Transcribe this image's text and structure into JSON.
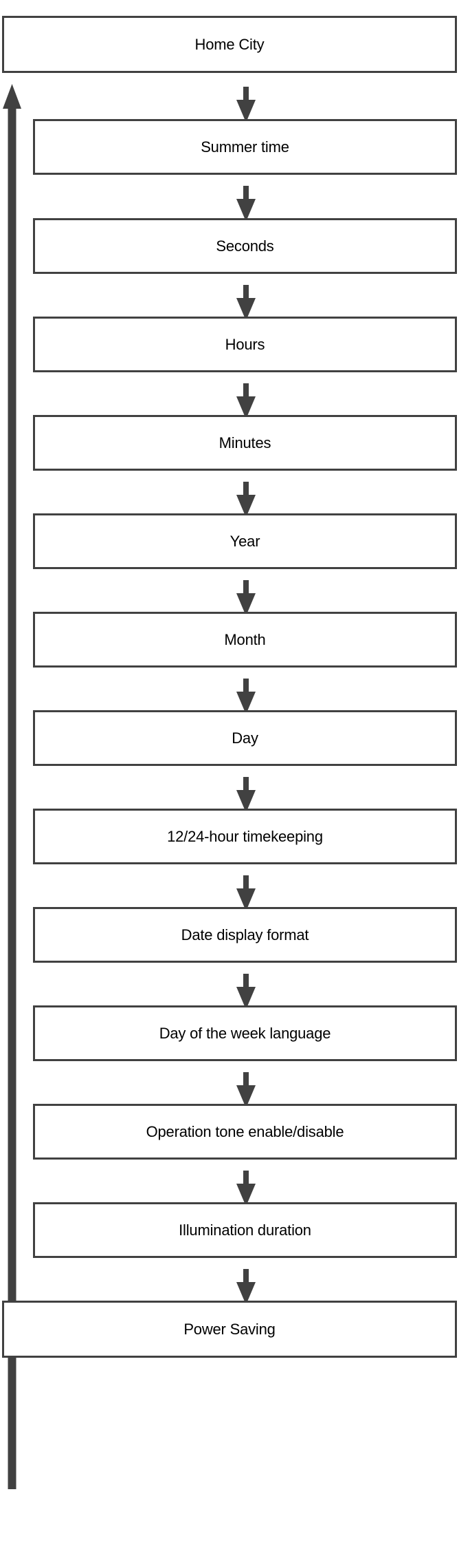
{
  "diagram": {
    "title": "Home City",
    "type": "vertical-flow-loop",
    "accent_color": "#414141",
    "text_color": "#000000",
    "background_color": "#ffffff",
    "nodes": [
      {
        "id": "home-city",
        "label": "Home City"
      },
      {
        "id": "summer-time",
        "label": "Summer time"
      },
      {
        "id": "seconds",
        "label": "Seconds"
      },
      {
        "id": "hours",
        "label": "Hours"
      },
      {
        "id": "minutes",
        "label": "Minutes"
      },
      {
        "id": "year",
        "label": "Year"
      },
      {
        "id": "month",
        "label": "Month"
      },
      {
        "id": "day",
        "label": "Day"
      },
      {
        "id": "timekeeping",
        "label": "12/24-hour timekeeping"
      },
      {
        "id": "date-format",
        "label": "Date display format"
      },
      {
        "id": "weekday-language",
        "label": "Day of the week language"
      },
      {
        "id": "operation-tone",
        "label": "Operation tone enable/disable"
      },
      {
        "id": "illumination",
        "label": "Illumination duration"
      },
      {
        "id": "power-saving",
        "label": "Power Saving"
      }
    ],
    "connectors": {
      "forward_arrow": "down-arrow",
      "return_arrow": "up-arrow",
      "return_from": "power-saving",
      "return_to": "home-city"
    }
  }
}
